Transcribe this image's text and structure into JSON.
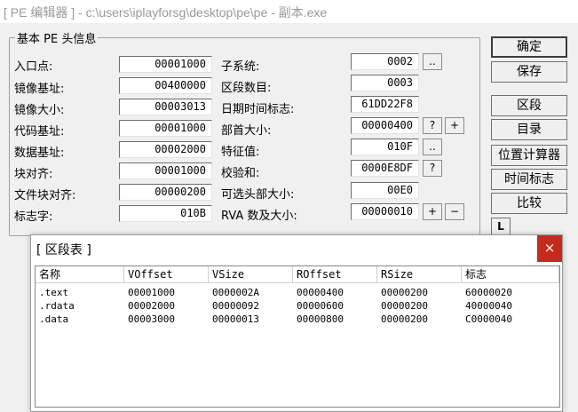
{
  "window": {
    "title": "[ PE 编辑器 ] - c:\\users\\iplayforsg\\desktop\\pe\\pe - 副本.exe"
  },
  "group": {
    "title": "基本 PE 头信息"
  },
  "fields": {
    "entry_point": {
      "label": "入口点:",
      "value": "00001000"
    },
    "image_base": {
      "label": "镜像基址:",
      "value": "00400000"
    },
    "image_size": {
      "label": "镜像大小:",
      "value": "00003013"
    },
    "code_base": {
      "label": "代码基址:",
      "value": "00001000"
    },
    "data_base": {
      "label": "数据基址:",
      "value": "00002000"
    },
    "section_alignment": {
      "label": "块对齐:",
      "value": "00001000"
    },
    "file_alignment": {
      "label": "文件块对齐:",
      "value": "00000200"
    },
    "magic": {
      "label": "标志字:",
      "value": "010B"
    },
    "subsystem": {
      "label": "子系统:",
      "value": "0002"
    },
    "num_sections": {
      "label": "区段数目:",
      "value": "0003"
    },
    "timestamp": {
      "label": "日期时间标志:",
      "value": "61DD22F8"
    },
    "header_size": {
      "label": "部首大小:",
      "value": "00000400"
    },
    "characteristics": {
      "label": "特征值:",
      "value": "010F"
    },
    "checksum": {
      "label": "校验和:",
      "value": "0000E8DF"
    },
    "opt_header_size": {
      "label": "可选头部大小:",
      "value": "00E0"
    },
    "rva_count": {
      "label": "RVA 数及大小:",
      "value": "00000010"
    }
  },
  "small_buttons": {
    "more": "..",
    "question": "?",
    "plus": "+",
    "minus": "−"
  },
  "buttons": {
    "ok": "确定",
    "save": "保存",
    "sections": "区段",
    "directories": "目录",
    "flc": "位置计算器",
    "timestamp": "时间标志",
    "compare": "比较",
    "l": "L"
  },
  "section_table": {
    "title": "[ 区段表 ]",
    "close": "×",
    "columns": [
      "名称",
      "VOffset",
      "VSize",
      "ROffset",
      "RSize",
      "标志"
    ],
    "rows": [
      [
        ".text",
        "00001000",
        "0000002A",
        "00000400",
        "00000200",
        "60000020"
      ],
      [
        ".rdata",
        "00002000",
        "00000092",
        "00000600",
        "00000200",
        "40000040"
      ],
      [
        ".data",
        "00003000",
        "00000013",
        "00000800",
        "00000200",
        "C0000040"
      ]
    ]
  }
}
